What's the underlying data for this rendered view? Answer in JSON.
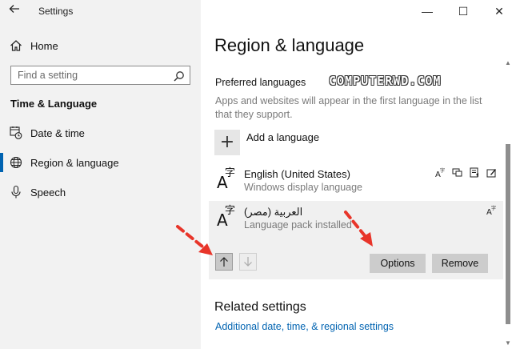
{
  "window": {
    "app_title": "Settings",
    "minimize_glyph": "—",
    "maximize_glyph": "☐",
    "close_glyph": "✕"
  },
  "sidebar": {
    "home_label": "Home",
    "search": {
      "placeholder": "Find a setting",
      "value": ""
    },
    "section_heading": "Time & Language",
    "items": [
      {
        "label": "Date & time",
        "icon": "calendar-clock-icon",
        "selected": false
      },
      {
        "label": "Region & language",
        "icon": "globe-icon",
        "selected": true
      },
      {
        "label": "Speech",
        "icon": "microphone-icon",
        "selected": false
      }
    ]
  },
  "main": {
    "page_title": "Region & language",
    "preferred_heading": "Preferred languages",
    "watermark": "COMPUTERWD.COM",
    "preferred_desc": "Apps and websites will appear in the first language in the list that they support.",
    "add_language_label": "Add a language",
    "languages": [
      {
        "name": "English (United States)",
        "sub": "Windows display language",
        "features": [
          "display-language-icon",
          "speech-icon",
          "tts-icon",
          "handwriting-icon"
        ]
      },
      {
        "name": "العربية (مصر)",
        "sub": "Language pack installed",
        "features": [
          "display-language-icon"
        ],
        "selected": true
      }
    ],
    "options_button": "Options",
    "remove_button": "Remove",
    "related_heading": "Related settings",
    "related_link": "Additional date, time, & regional settings"
  },
  "colors": {
    "accent": "#0063b1",
    "annotation_arrow": "#e8352a",
    "sidebar_bg": "#f2f2f2",
    "selected_item_bg": "#f0f0f0",
    "button_bg": "#cccccc"
  }
}
